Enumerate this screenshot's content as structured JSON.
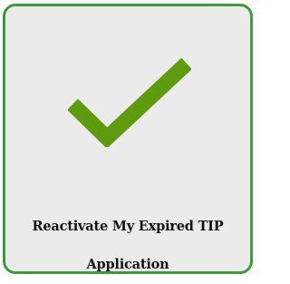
{
  "tile": {
    "icon": "checkmark-icon",
    "label_line1": "Reactivate My Expired TIP",
    "label_line2": "Application"
  },
  "colors": {
    "border": "#3d9a3d",
    "background": "#ebebeb",
    "checkmark": "#5e9c0d",
    "text": "#111111"
  }
}
